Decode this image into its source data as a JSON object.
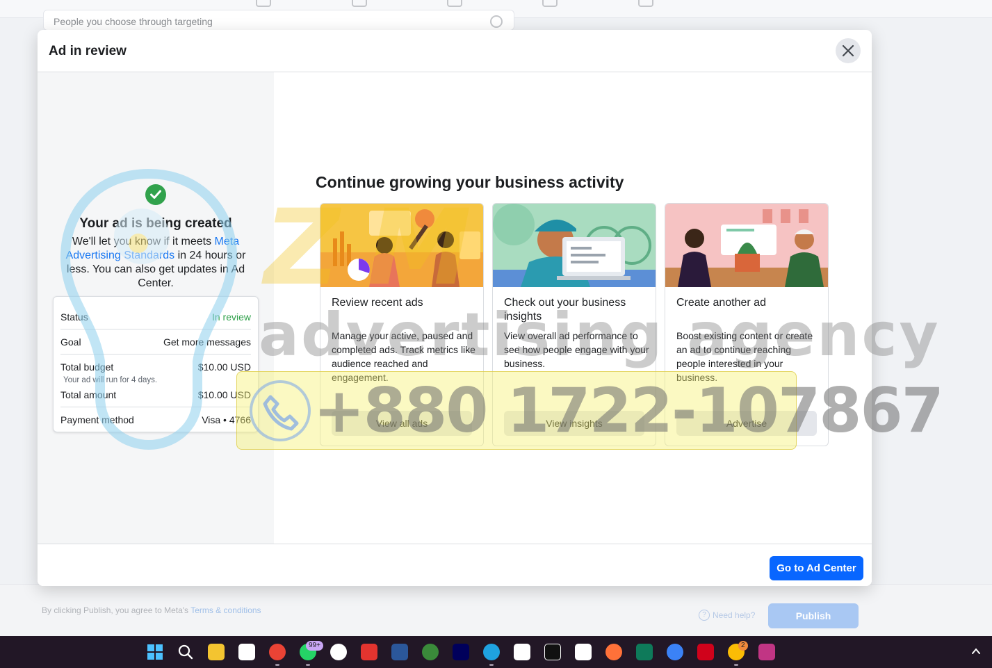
{
  "background": {
    "targeting_text": "People you choose through targeting",
    "footer_terms_prefix": "By clicking Publish, you agree to Meta's ",
    "footer_terms_link": "Terms & conditions",
    "need_help": "Need help?",
    "publish_label": "Publish"
  },
  "modal": {
    "title": "Ad in review",
    "left": {
      "heading": "Your ad is being created",
      "desc_before": "We'll let you know if it meets ",
      "desc_link": "Meta Advertising Standards",
      "desc_after": " in 24 hours or less. You can also get updates in Ad Center.",
      "summary": {
        "status_label": "Status",
        "status_value": "In review",
        "goal_label": "Goal",
        "goal_value": "Get more messages",
        "budget_label": "Total budget",
        "budget_value": "$10.00 USD",
        "budget_note": "Your ad will run for 4 days.",
        "amount_label": "Total amount",
        "amount_value": "$10.00 USD",
        "payment_label": "Payment method",
        "payment_value": "Visa • 4766"
      }
    },
    "main_title": "Continue growing your business activity",
    "cards": [
      {
        "title": "Review recent ads",
        "desc": "Manage your active, paused and completed ads. Track metrics like audience reached and engagement.",
        "button": "View all ads"
      },
      {
        "title": "Check out your business insights",
        "desc": "View overall ad performance to see how people engage with your business.",
        "button": "View insights"
      },
      {
        "title": "Create another ad",
        "desc": "Boost existing content or create an ad to continue reaching people interested in your business.",
        "button": "Advertise"
      }
    ],
    "footer_button": "Go to Ad Center"
  },
  "watermark": {
    "brand": "ZM",
    "tagline": "advertising agency",
    "phone": "+880 1722-107867"
  },
  "taskbar": {
    "whatsapp_badge": "99+",
    "chrome_badge": "2"
  },
  "colors": {
    "primary_blue": "#0866ff",
    "link_blue": "#1877f2",
    "status_green": "#31a24c",
    "taskbar_bg": "#221726"
  }
}
